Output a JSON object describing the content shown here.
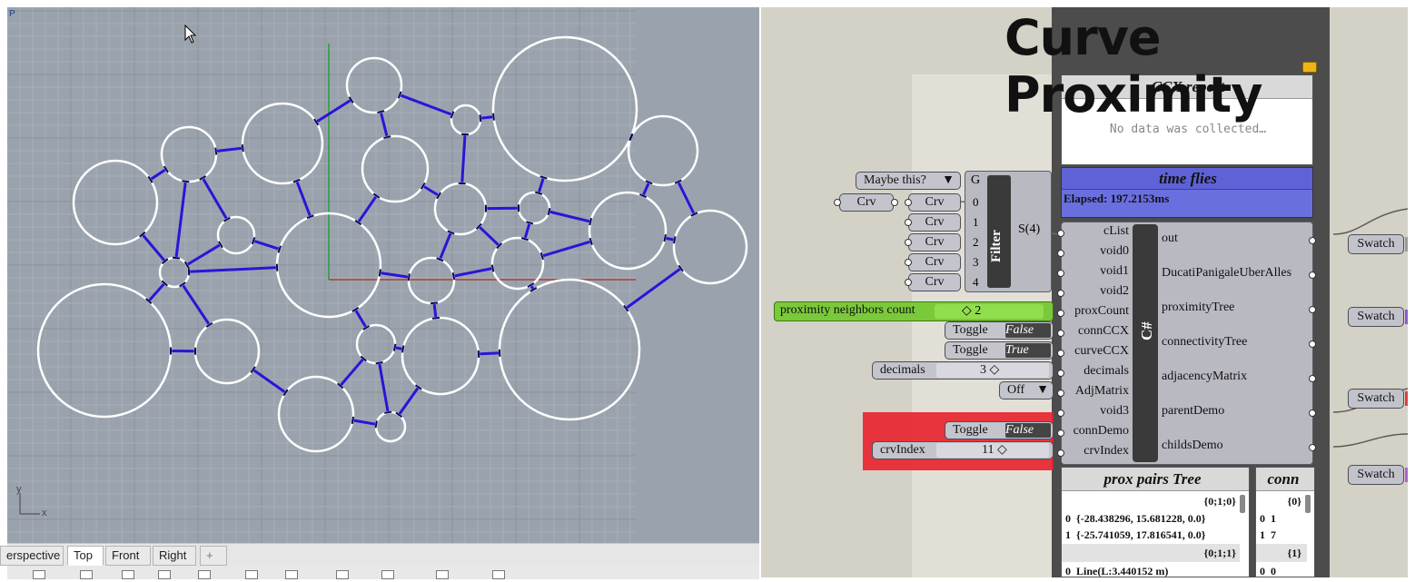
{
  "viewport": {
    "tabs": [
      "erspective",
      "Top",
      "Front",
      "Right",
      "+"
    ],
    "active_tab": "Top",
    "axis_labels": {
      "x": "x",
      "y": "y"
    },
    "corner_label": "P",
    "colors": {
      "background": "#9aa3ad",
      "grid": "#a7afb8",
      "circle": "#ffffff",
      "connection": "#2b14d8",
      "x_axis": "#b23a3a",
      "y_axis": "#2a9a3a"
    }
  },
  "canvas": {
    "title": "Curve Proximity",
    "ccx_report": {
      "title": "CCX report",
      "message": "No data was collected…"
    },
    "time_flies": {
      "title": "time flies",
      "elapsed": "Elapsed: 197.2153ms"
    },
    "maybe_dropdown": "Maybe this?",
    "crv_param": "Crv",
    "filter": {
      "label": "Filter",
      "gate": "G",
      "inputs": [
        {
          "name": "Crv",
          "index": "0"
        },
        {
          "name": "Crv",
          "index": "1"
        },
        {
          "name": "Crv",
          "index": "2"
        },
        {
          "name": "Crv",
          "index": "3"
        },
        {
          "name": "Crv",
          "index": "4"
        }
      ],
      "output": "S(4)"
    },
    "slider_prox": {
      "label": "proximity neighbors count",
      "value": "2"
    },
    "toggle_conn": {
      "label": "Toggle",
      "value": "False"
    },
    "toggle_curve": {
      "label": "Toggle",
      "value": "True"
    },
    "slider_decimals": {
      "label": "decimals",
      "value": "3"
    },
    "adj_dropdown": "Off",
    "toggle_demo": {
      "label": "Toggle",
      "value": "False"
    },
    "slider_crv": {
      "label": "crvIndex",
      "value": "11"
    },
    "csharp": {
      "label": "C#",
      "inputs": [
        "cList",
        "void0",
        "void1",
        "void2",
        "proxCount",
        "connCCX",
        "curveCCX",
        "decimals",
        "AdjMatrix",
        "void3",
        "connDemo",
        "crvIndex"
      ],
      "outputs": [
        "out",
        "DucatiPanigaleUberAlles",
        "proximityTree",
        "connectivityTree",
        "adjacencyMatrix",
        "parentDemo",
        "childsDemo"
      ]
    },
    "swatches": [
      "Swatch",
      "Swatch",
      "Swatch",
      "Swatch"
    ],
    "swatch_colors": [
      "#9a9aa0",
      "#8a5ad8",
      "#e04040",
      "#b060d0"
    ],
    "prox_tree": {
      "title": "prox pairs Tree",
      "branch0": "{0;1;0}",
      "rows0": [
        {
          "index": "0",
          "value": "{-28.438296, 15.681228, 0.0}"
        },
        {
          "index": "1",
          "value": "{-25.741059, 17.816541, 0.0}"
        }
      ],
      "branch1": "{0;1;1}",
      "rows1": [
        {
          "index": "0",
          "value": "Line(L:3.440152 m)"
        }
      ]
    },
    "conn_tree": {
      "title": "conn",
      "branch0": "{0}",
      "rows0": [
        {
          "index": "0",
          "value": "1"
        },
        {
          "index": "1",
          "value": "7"
        }
      ],
      "branch1": "{1}",
      "rows1": [
        {
          "index": "0",
          "value": "0"
        }
      ]
    }
  }
}
